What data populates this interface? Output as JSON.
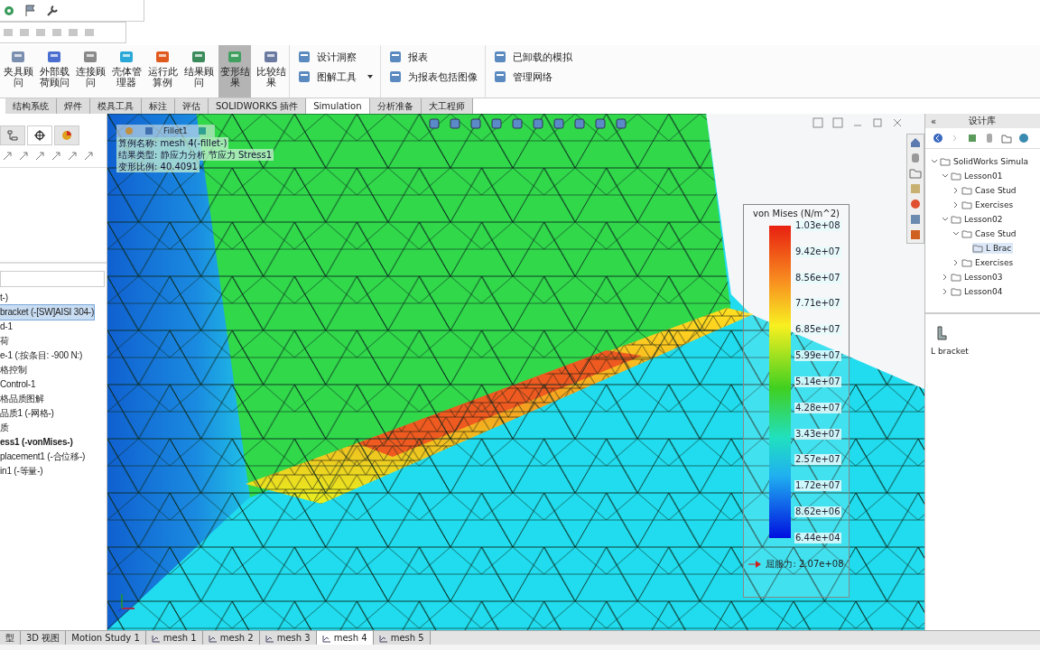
{
  "ribbon": {
    "large_buttons": [
      {
        "label": "夹具顾问",
        "selected": false
      },
      {
        "label": "外部载荷顾问",
        "selected": false
      },
      {
        "label": "连接顾问",
        "selected": false
      },
      {
        "label": "壳体管理器",
        "selected": false
      },
      {
        "label": "运行此算例",
        "selected": false
      },
      {
        "label": "结果顾问",
        "selected": false
      },
      {
        "label": "变形结果",
        "selected": true
      },
      {
        "label": "比较结果",
        "selected": false
      }
    ],
    "small_columns": [
      [
        {
          "label": "设计洞察",
          "has_menu": false
        },
        {
          "label": "图解工具",
          "has_menu": true
        }
      ],
      [
        {
          "label": "报表",
          "has_menu": false
        },
        {
          "label": "为报表包括图像",
          "has_menu": false
        }
      ],
      [
        {
          "label": "已卸载的模拟",
          "has_menu": false
        },
        {
          "label": "管理网络",
          "has_menu": false
        }
      ]
    ]
  },
  "tabs": [
    {
      "label": "结构系统",
      "selected": false
    },
    {
      "label": "焊件",
      "selected": false
    },
    {
      "label": "模具工具",
      "selected": false
    },
    {
      "label": "标注",
      "selected": false
    },
    {
      "label": "评估",
      "selected": false
    },
    {
      "label": "SOLIDWORKS 插件",
      "selected": false
    },
    {
      "label": "Simulation",
      "selected": true
    },
    {
      "label": "分析准备",
      "selected": false
    },
    {
      "label": "大工程师",
      "selected": false
    }
  ],
  "left_panel": {
    "tree": [
      {
        "label": "t-)",
        "selected": false,
        "bold": false
      },
      {
        "label": "bracket (-[SW]AISI 304-)",
        "selected": true,
        "bold": false
      },
      {
        "label": "d-1",
        "selected": false,
        "bold": false
      },
      {
        "label": "荷",
        "selected": false,
        "bold": false
      },
      {
        "label": "e-1 (:按条目: -900 N:)",
        "selected": false,
        "bold": false
      },
      {
        "label": "格控制",
        "selected": false,
        "bold": false
      },
      {
        "label": "Control-1",
        "selected": false,
        "bold": false
      },
      {
        "label": "格品质图解",
        "selected": false,
        "bold": false
      },
      {
        "label": "品质1 (-网格-)",
        "selected": false,
        "bold": false
      },
      {
        "label": "质",
        "selected": false,
        "bold": false
      },
      {
        "label": "ess1 (-vonMises-)",
        "selected": false,
        "bold": true
      },
      {
        "label": "placement1 (-合位移-)",
        "selected": false,
        "bold": false
      },
      {
        "label": "in1 (-等量-)",
        "selected": false,
        "bold": false
      }
    ]
  },
  "viewport": {
    "breadcrumb": "Fillet1",
    "info_lines": [
      "算例名称: mesh 4(-fillet-)",
      "结果类型: 静应力分析 节应力 Stress1",
      "变形比例: 40.4091"
    ],
    "legend": {
      "title": "von Mises (N/m^2)",
      "labels": [
        "1.03e+08",
        "9.42e+07",
        "8.56e+07",
        "7.71e+07",
        "6.85e+07",
        "5.99e+07",
        "5.14e+07",
        "4.28e+07",
        "3.43e+07",
        "2.57e+07",
        "1.72e+07",
        "8.62e+06",
        "6.44e+04"
      ],
      "yield_label": "屈服力: 2.07e+08"
    }
  },
  "design_library": {
    "collapse_label": "«",
    "title": "设计库",
    "tree": [
      {
        "label": "SolidWorks Simula",
        "expanded": true,
        "selected": false,
        "children": [
          {
            "label": "Lesson01",
            "expanded": true,
            "selected": false,
            "children": [
              {
                "label": "Case Stud",
                "expanded": false,
                "selected": false
              },
              {
                "label": "Exercises",
                "expanded": false,
                "selected": false
              }
            ]
          },
          {
            "label": "Lesson02",
            "expanded": true,
            "selected": false,
            "children": [
              {
                "label": "Case Stud",
                "expanded": true,
                "selected": false,
                "children": [
                  {
                    "label": "L Brac",
                    "selected": true
                  }
                ]
              },
              {
                "label": "Exercises",
                "expanded": false,
                "selected": false
              }
            ]
          },
          {
            "label": "Lesson03",
            "expanded": false,
            "selected": false
          },
          {
            "label": "Lesson04",
            "expanded": false,
            "selected": false
          }
        ]
      }
    ],
    "files": [
      {
        "label": "L bracket"
      }
    ]
  },
  "bottom_tabs": [
    {
      "label": "型",
      "selected": false,
      "kind": "view"
    },
    {
      "label": "3D 视图",
      "selected": false,
      "kind": "view"
    },
    {
      "label": "Motion Study 1",
      "selected": false,
      "kind": "view"
    },
    {
      "label": "mesh 1",
      "selected": false,
      "kind": "study"
    },
    {
      "label": "mesh 2",
      "selected": false,
      "kind": "study"
    },
    {
      "label": "mesh 3",
      "selected": false,
      "kind": "study"
    },
    {
      "label": "mesh 4",
      "selected": true,
      "kind": "study"
    },
    {
      "label": "mesh 5",
      "selected": false,
      "kind": "study"
    }
  ]
}
